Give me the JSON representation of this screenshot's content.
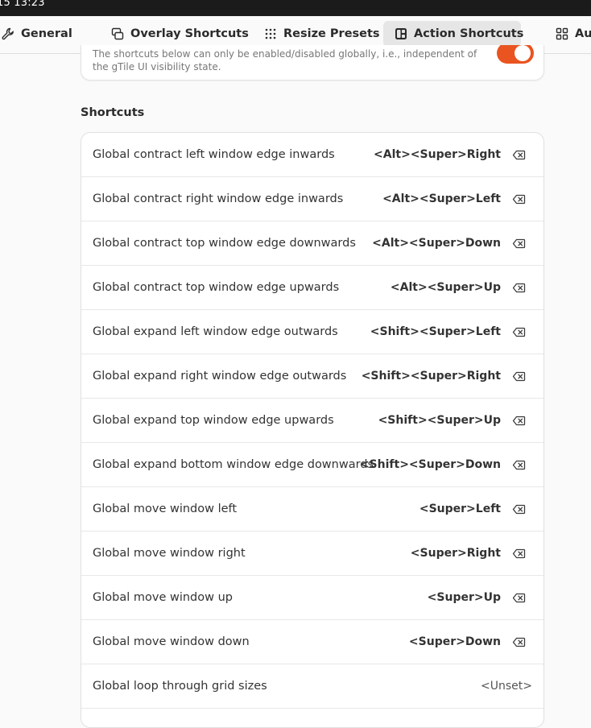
{
  "status": {
    "clock": "15  13:23"
  },
  "tabs": [
    {
      "label": "General",
      "icon": "wrench-icon"
    },
    {
      "label": "Overlay Shortcuts",
      "icon": "overlay-icon"
    },
    {
      "label": "Resize Presets",
      "icon": "grid-dots-icon"
    },
    {
      "label": "Action Shortcuts",
      "icon": "action-shortcuts-icon",
      "active": true
    },
    {
      "label": "Aut",
      "icon": "grid-squares-icon"
    }
  ],
  "banner": {
    "description": "The shortcuts below can only be enabled/disabled globally, i.e., independent of the gTile UI visibility state.",
    "toggle_on": true
  },
  "section_title": "Shortcuts",
  "shortcuts": [
    {
      "label": "Global contract left window edge inwards",
      "accel": "<Alt><Super>Right"
    },
    {
      "label": "Global contract right window edge inwards",
      "accel": "<Alt><Super>Left"
    },
    {
      "label": "Global contract top window edge downwards",
      "accel": "<Alt><Super>Down"
    },
    {
      "label": "Global contract top window edge upwards",
      "accel": "<Alt><Super>Up"
    },
    {
      "label": "Global expand left window edge outwards",
      "accel": "<Shift><Super>Left"
    },
    {
      "label": "Global expand right window edge outwards",
      "accel": "<Shift><Super>Right"
    },
    {
      "label": "Global expand top window edge upwards",
      "accel": "<Shift><Super>Up"
    },
    {
      "label": "Global expand bottom window edge downwards",
      "accel": "<Shift><Super>Down"
    },
    {
      "label": "Global move window left",
      "accel": "<Super>Left"
    },
    {
      "label": "Global move window right",
      "accel": "<Super>Right"
    },
    {
      "label": "Global move window up",
      "accel": "<Super>Up"
    },
    {
      "label": "Global move window down",
      "accel": "<Super>Down"
    },
    {
      "label": "Global loop through grid sizes",
      "accel": "<Unset>"
    }
  ],
  "colors": {
    "accent": "#e95420",
    "topbar": "#1b1b1b"
  }
}
